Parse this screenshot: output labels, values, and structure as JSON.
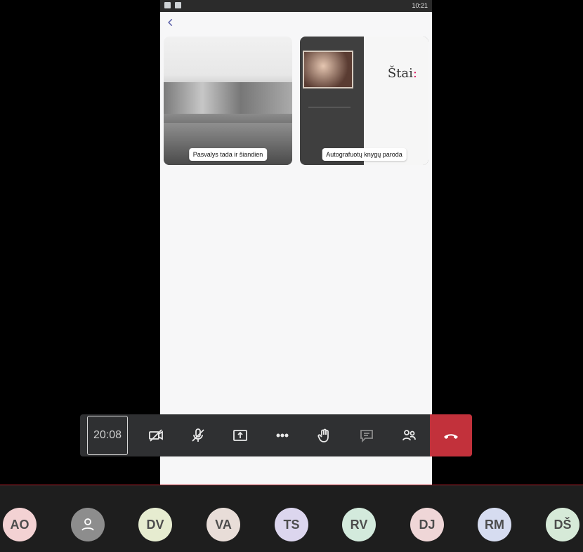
{
  "status_bar": {
    "time": "10:21"
  },
  "cards": [
    {
      "label": "Pasvalys tada ir šiandien"
    },
    {
      "label": "Autografuotų knygų paroda"
    }
  ],
  "book": {
    "title": "Štai",
    "colon": ":"
  },
  "toolbar": {
    "timer": "20:08",
    "icons": [
      "camera-off-icon",
      "mic-off-icon",
      "share-screen-icon",
      "more-icon",
      "raise-hand-icon",
      "chat-icon",
      "participants-icon",
      "hang-up-icon"
    ]
  },
  "participants": [
    {
      "initials": "AO",
      "bg": "#f3d2d3"
    },
    {
      "initials": "",
      "bg": "#8d8d8d"
    },
    {
      "initials": "DV",
      "bg": "#e6ecd0"
    },
    {
      "initials": "VA",
      "bg": "#e8ddd8"
    },
    {
      "initials": "TS",
      "bg": "#dcd6ee"
    },
    {
      "initials": "RV",
      "bg": "#d3eadc"
    },
    {
      "initials": "DJ",
      "bg": "#efd6d7"
    },
    {
      "initials": "RM",
      "bg": "#d6dcf0"
    },
    {
      "initials": "DŠ",
      "bg": "#d6ead8"
    }
  ],
  "colors": {
    "hangup": "#c2313b",
    "toolbar": "#2f3032"
  }
}
